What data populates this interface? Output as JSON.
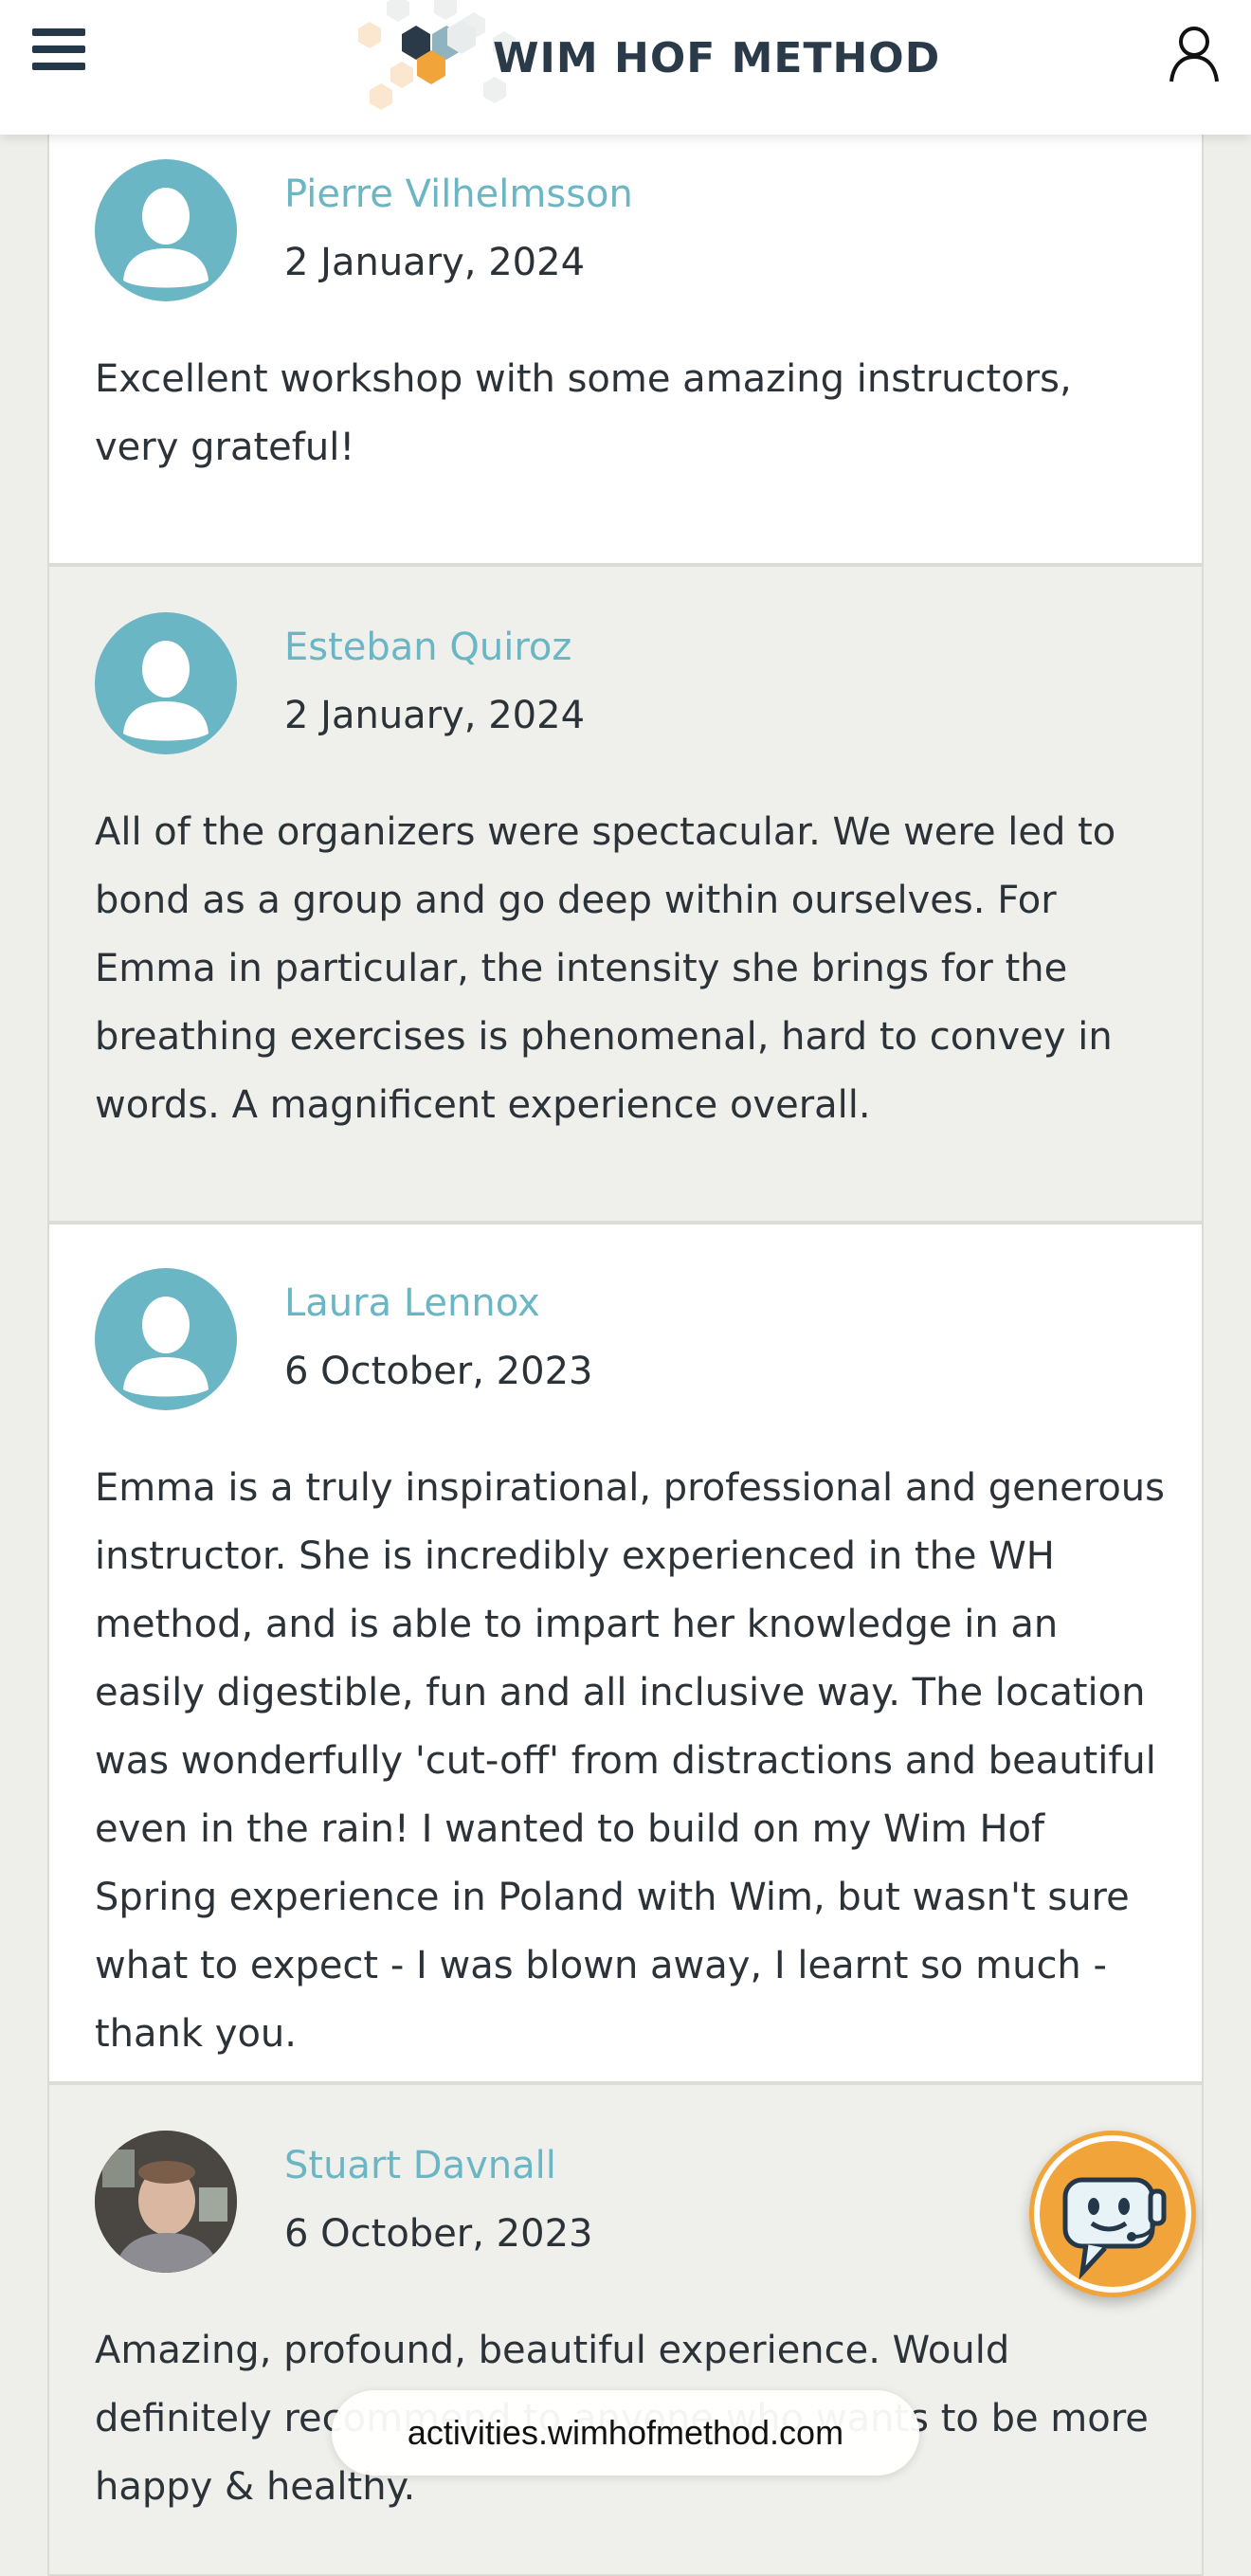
{
  "header": {
    "logo_text": "WIM HOF METHOD",
    "menu_icon": "hamburger-menu-icon",
    "account_icon": "user-account-icon"
  },
  "reviews": [
    {
      "name": "Pierre Vilhelmsson",
      "date": "2 January, 2024",
      "text": "Excellent workshop with some amazing instructors, very grateful!",
      "avatar": "default-avatar-icon"
    },
    {
      "name": "Esteban Quiroz",
      "date": "2 January, 2024",
      "text": "All of the organizers were spectacular. We were led to bond as a group and go deep within ourselves. For Emma in particular, the intensity she brings for the breathing exercises is phenomenal, hard to convey in words. A magnificent experience overall.",
      "avatar": "default-avatar-icon"
    },
    {
      "name": "Laura Lennox",
      "date": "6 October, 2023",
      "text": "Emma is a truly inspirational, professional and generous instructor. She is incredibly experienced in the WH method, and is able to impart her knowledge in an easily digestible, fun and all inclusive way. The location was wonderfully 'cut-off' from distractions and beautiful even in the rain! I wanted to build on my Wim Hof Spring experience in Poland with Wim, but wasn't sure what to expect - I was blown away, I learnt so much - thank you.",
      "avatar": "default-avatar-icon"
    },
    {
      "name": "Stuart Davnall",
      "date": "6 October, 2023",
      "text": "Amazing, profound, beautiful experience. Would definitely recommend to anyone who wants to be more happy & healthy.",
      "avatar": "user-photo"
    }
  ],
  "url_bar": {
    "text": "activities.wimhofmethod.com"
  },
  "chat": {
    "icon": "chatbot-icon"
  },
  "colors": {
    "accent_name": "#6ab6c4",
    "header_text": "#2a3a48",
    "chat_bg": "#f0a43a",
    "page_bg": "#eeeeea"
  }
}
